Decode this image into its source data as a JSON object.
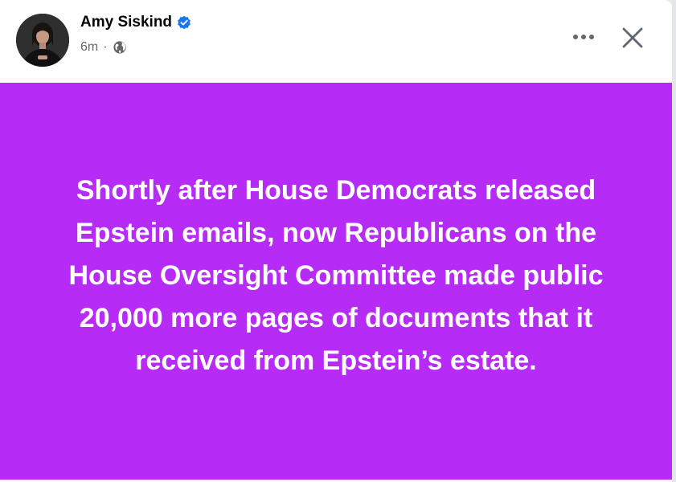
{
  "post": {
    "author": {
      "name": "Amy Siskind",
      "verified": true
    },
    "meta": {
      "time": "6m",
      "separator": "·",
      "audience_icon": "globe-icon"
    },
    "actions": {
      "more_icon": "more-options-icon",
      "close_icon": "close-icon"
    },
    "body_text": "Shortly after House Democrats released Epstein emails, now Republicans on the House Oversight Committee made public 20,000 more pages of documents that it received from Epstein’s estate.",
    "background_color": "#b62cf6",
    "text_color": "#ffffff"
  },
  "colors": {
    "verified": "#1877f2",
    "icon_gray": "#65676b",
    "name": "#050505"
  }
}
